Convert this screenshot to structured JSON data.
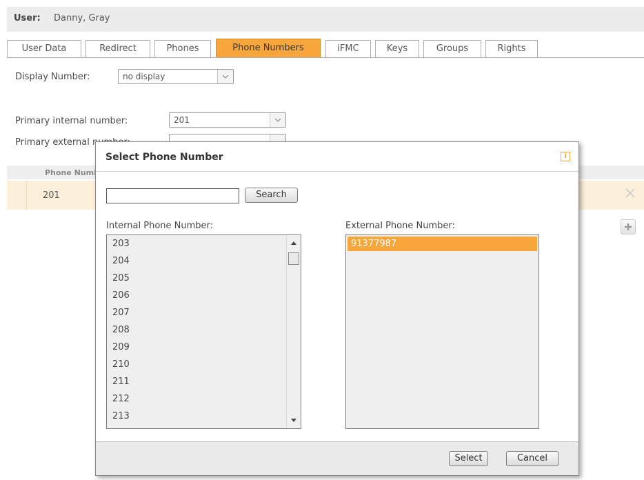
{
  "user": {
    "label": "User:",
    "name": "Danny, Gray"
  },
  "tabs": [
    {
      "label": "User Data"
    },
    {
      "label": "Redirect"
    },
    {
      "label": "Phones"
    },
    {
      "label": "Phone Numbers",
      "active": true
    },
    {
      "label": "iFMC"
    },
    {
      "label": "Keys"
    },
    {
      "label": "Groups"
    },
    {
      "label": "Rights"
    }
  ],
  "display": {
    "label": "Display Number:",
    "value": "no display"
  },
  "primary_internal": {
    "label": "Primary internal number:",
    "value": "201"
  },
  "primary_external": {
    "label": "Primary external number:"
  },
  "table": {
    "header": "Phone Number",
    "row_value": "201"
  },
  "dialog": {
    "title": "Select Phone Number",
    "search_value": "",
    "search_button": "Search",
    "internal_label": "Internal Phone Number:",
    "internal_items": [
      "203",
      "204",
      "205",
      "206",
      "207",
      "208",
      "209",
      "210",
      "211",
      "212",
      "213"
    ],
    "external_label": "External Phone Number:",
    "external_items": [
      "91377987"
    ],
    "select_button": "Select",
    "cancel_button": "Cancel"
  },
  "colors": {
    "accent": "#f7a63c",
    "row_highlight": "#fdf0da"
  }
}
